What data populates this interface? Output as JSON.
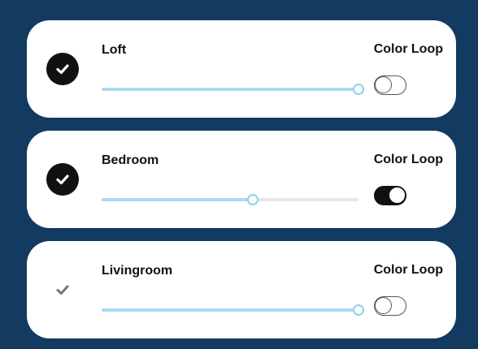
{
  "rooms": [
    {
      "name": "Loft",
      "selected": true,
      "check_icon": "check-circle-filled-icon",
      "color_loop_label": "Color Loop",
      "color_loop_on": false,
      "brightness": 1.0
    },
    {
      "name": "Bedroom",
      "selected": true,
      "check_icon": "check-circle-filled-icon",
      "color_loop_label": "Color Loop",
      "color_loop_on": true,
      "brightness": 0.59
    },
    {
      "name": "Livingroom",
      "selected": false,
      "check_icon": "check-mark-icon",
      "color_loop_label": "Color Loop",
      "color_loop_on": false,
      "brightness": 1.0
    }
  ],
  "colors": {
    "background": "#133a60",
    "card": "#ffffff",
    "slider_fill": "#a8dcf2",
    "slider_track": "#e6e6e6",
    "check_on": "#111111",
    "check_off": "#777777"
  }
}
